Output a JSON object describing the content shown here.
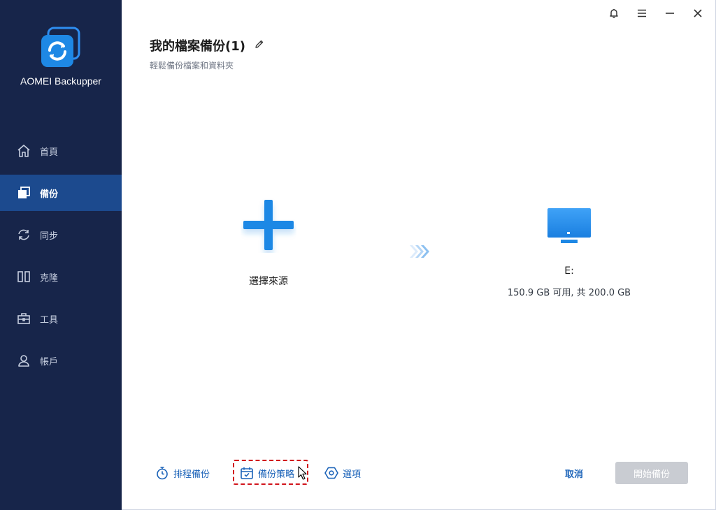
{
  "app": {
    "name": "AOMEI Backupper"
  },
  "sidebar": {
    "items": [
      {
        "label": "首頁",
        "icon": "home-icon"
      },
      {
        "label": "備份",
        "icon": "backup-icon",
        "active": true
      },
      {
        "label": "同步",
        "icon": "sync-icon"
      },
      {
        "label": "克隆",
        "icon": "clone-icon"
      },
      {
        "label": "工具",
        "icon": "tools-icon"
      },
      {
        "label": "帳戶",
        "icon": "account-icon"
      }
    ]
  },
  "header": {
    "title": "我的檔案備份(1)",
    "subtitle": "輕鬆備份檔案和資料夾"
  },
  "source": {
    "label": "選擇來源"
  },
  "destination": {
    "name": "E:",
    "info": "150.9 GB 可用, 共 200.0 GB"
  },
  "footer": {
    "schedule_label": "排程備份",
    "scheme_label": "備份策略",
    "options_label": "選項",
    "cancel_label": "取消",
    "start_label": "開始備份"
  },
  "colors": {
    "sidebar_bg": "#17254a",
    "sidebar_active": "#1c4a8e",
    "accent": "#1e88e5",
    "link": "#1a62b8",
    "highlight": "#d1141b",
    "disabled_button": "#c9ccd2"
  }
}
